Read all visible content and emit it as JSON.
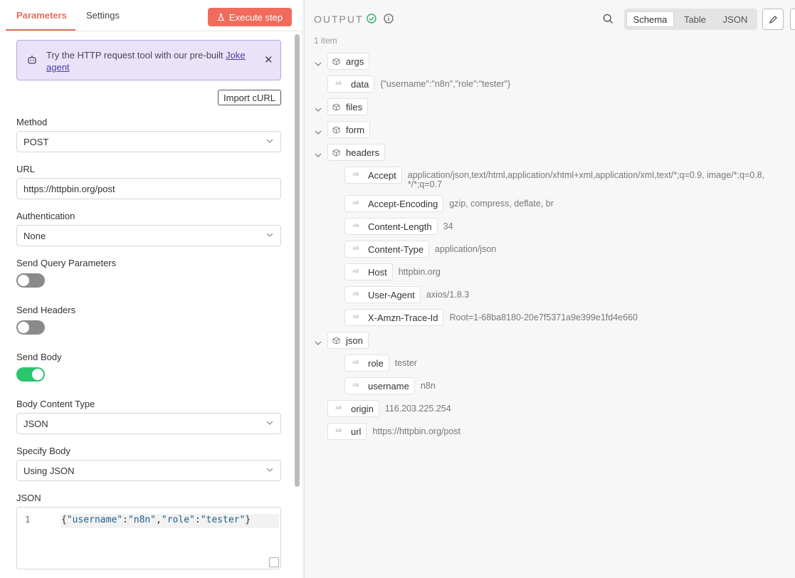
{
  "tabs": {
    "parameters": "Parameters",
    "settings": "Settings"
  },
  "execute_label": "Execute step",
  "callout": {
    "text": "Try the HTTP request tool with our pre-built ",
    "link": "Joke agent"
  },
  "import_curl": "Import cURL",
  "form": {
    "method_label": "Method",
    "method_value": "POST",
    "url_label": "URL",
    "url_value": "https://httpbin.org/post",
    "auth_label": "Authentication",
    "auth_value": "None",
    "query_label": "Send Query Parameters",
    "query_on": false,
    "headers_label": "Send Headers",
    "headers_on": false,
    "body_label": "Send Body",
    "body_on": true,
    "body_type_label": "Body Content Type",
    "body_type_value": "JSON",
    "specify_label": "Specify Body",
    "specify_value": "Using JSON",
    "json_label": "JSON",
    "json_line_no": "1"
  },
  "output": {
    "title": "OUTPUT",
    "count": "1 item",
    "views": [
      "Schema",
      "Table",
      "JSON"
    ],
    "active_view": "Schema",
    "tree": [
      {
        "key": "args",
        "kind": "object"
      },
      {
        "key": "data",
        "kind": "string",
        "value": "{\"username\":\"n8n\",\"role\":\"tester\"}"
      },
      {
        "key": "files",
        "kind": "object"
      },
      {
        "key": "form",
        "kind": "object"
      },
      {
        "key": "headers",
        "kind": "object"
      },
      {
        "key": "Accept",
        "kind": "string",
        "value": "application/json,text/html,application/xhtml+xml,application/xml,text/*;q=0.9, image/*;q=0.8, */*;q=0.7"
      },
      {
        "key": "Accept-Encoding",
        "kind": "string",
        "value": "gzip, compress, deflate, br"
      },
      {
        "key": "Content-Length",
        "kind": "string",
        "value": "34"
      },
      {
        "key": "Content-Type",
        "kind": "string",
        "value": "application/json"
      },
      {
        "key": "Host",
        "kind": "string",
        "value": "httpbin.org"
      },
      {
        "key": "User-Agent",
        "kind": "string",
        "value": "axios/1.8.3"
      },
      {
        "key": "X-Amzn-Trace-Id",
        "kind": "string",
        "value": "Root=1-68ba8180-20e7f5371a9e399e1fd4e660"
      },
      {
        "key": "json",
        "kind": "object"
      },
      {
        "key": "role",
        "kind": "string",
        "value": "tester"
      },
      {
        "key": "username",
        "kind": "string",
        "value": "n8n"
      },
      {
        "key": "origin",
        "kind": "string",
        "value": "116.203.225.254"
      },
      {
        "key": "url",
        "kind": "string",
        "value": "https://httpbin.org/post"
      }
    ],
    "type_abbrev": "AB"
  },
  "colors": {
    "accent": "#f06b5b",
    "toggle_on": "#29c66b",
    "callout_bg": "#e9e2f8"
  }
}
